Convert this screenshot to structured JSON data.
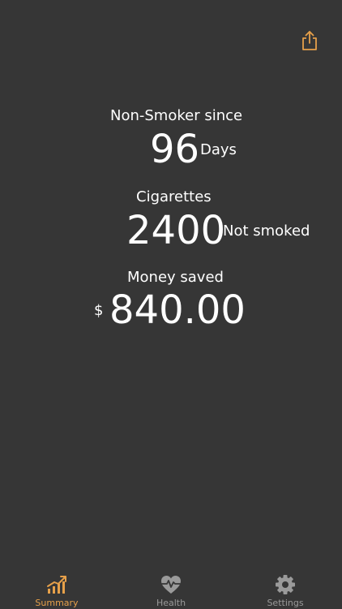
{
  "theme": {
    "background": "#363636",
    "accent": "#e6a04a",
    "inactive": "#9a9a9a",
    "text": "#ffffff"
  },
  "header": {
    "share_icon": "share-icon"
  },
  "stats": {
    "nonsmoker": {
      "label": "Non-Smoker since",
      "value": "96",
      "unit": "Days"
    },
    "cigarettes": {
      "label": "Cigarettes",
      "value": "2400",
      "unit": "Not smoked"
    },
    "money": {
      "label": "Money saved",
      "currency": "$",
      "value": "840.00"
    }
  },
  "tabbar": {
    "tabs": [
      {
        "label": "Summary",
        "icon": "chart-trend-icon",
        "active": true
      },
      {
        "label": "Health",
        "icon": "heart-pulse-icon",
        "active": false
      },
      {
        "label": "Settings",
        "icon": "gear-icon",
        "active": false
      }
    ]
  }
}
